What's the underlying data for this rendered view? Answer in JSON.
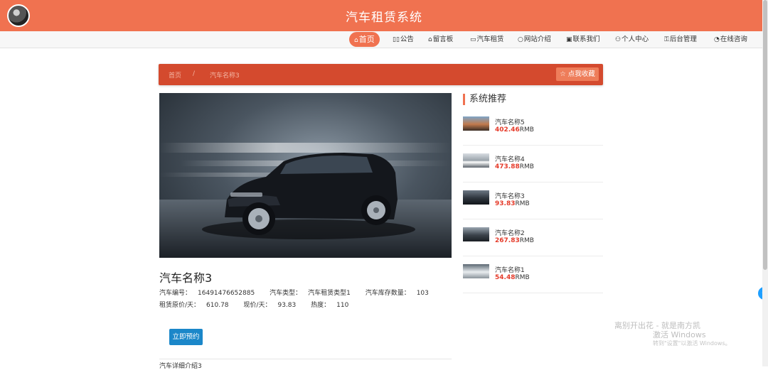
{
  "header": {
    "title": "汽车租赁系统"
  },
  "nav": {
    "home": {
      "icon": "⌂",
      "label": "首页"
    },
    "items": [
      {
        "icon": "▯▯",
        "label": "公告"
      },
      {
        "icon": "⌂",
        "label": "留言板"
      },
      {
        "icon": "▭",
        "label": "汽车租赁"
      },
      {
        "icon": "○",
        "label": "网站介绍"
      },
      {
        "icon": "▣",
        "label": "联系我们"
      },
      {
        "icon": "⚇",
        "label": "个人中心"
      },
      {
        "icon": "⚿",
        "label": "后台管理"
      },
      {
        "icon": "◔",
        "label": "在线咨询"
      }
    ]
  },
  "breadcrumb": {
    "home": "首页",
    "separator": "/",
    "current": "汽车名称3"
  },
  "favorite": {
    "icon": "☆",
    "label": "点我收藏"
  },
  "car": {
    "name": "汽车名称3",
    "number_label": "汽车编号：",
    "number": "16491476652885",
    "type_label": "汽车类型：",
    "type": "汽车租赁类型1",
    "stock_label": "汽车库存数量：",
    "stock": "103",
    "orig_price_label": "租赁原价/天：",
    "orig_price": "610.78",
    "price_label": "现价/天：",
    "price": "93.83",
    "hot_label": "热度：",
    "hot": "110"
  },
  "book_button": "立即预约",
  "detail_title": "汽车详细介绍3",
  "recommend": {
    "title": "系统推荐",
    "currency": "RMB",
    "items": [
      {
        "name": "汽车名称5",
        "price": "402.46"
      },
      {
        "name": "汽车名称4",
        "price": "473.88"
      },
      {
        "name": "汽车名称3",
        "price": "93.83"
      },
      {
        "name": "汽车名称2",
        "price": "267.83"
      },
      {
        "name": "汽车名称1",
        "price": "54.48"
      }
    ]
  },
  "side_toggle": "‹",
  "watermark": {
    "line1": "离别开出花 - 就是南方凯",
    "line2": "激活 Windows",
    "line3": "转到\"设置\"以激活 Windows。"
  }
}
